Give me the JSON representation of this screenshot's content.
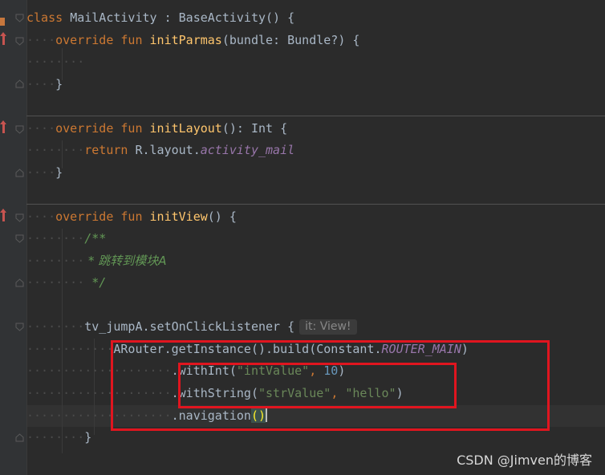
{
  "code": {
    "class_kw": "class",
    "class_name": "MailActivity",
    "class_rest": " : BaseActivity() {",
    "override_kw": "override",
    "fun_kw": "fun",
    "return_kw": "return",
    "m1_name": "initParmas",
    "m1_params": "(bundle: Bundle?) {",
    "close_brace": "}",
    "m2_name": "initLayout",
    "m2_sig": "(): Int {",
    "layout_ref": "R.layout.",
    "layout_name": "activity_mail",
    "m3_name": "initView",
    "m3_sig": "() {",
    "doc_open": "/**",
    "doc_text": " * 跳转到模块A",
    "doc_close": " */",
    "listener_call": "tv_jumpA.setOnClickListener {",
    "param_hint": "it: View!",
    "arouter_call": "ARouter.getInstance().build(Constant.",
    "router_const": "ROUTER_MAIN",
    "close_paren": ")",
    "with_int": ".withInt(",
    "int_key": "\"intValue\"",
    "comma": ", ",
    "int_val": "10",
    "with_string": ".withString(",
    "str_key": "\"strValue\"",
    "str_val": "\"hello\"",
    "navigation": ".navigation",
    "nav_parens": "()"
  },
  "watermark": "CSDN @Jimven的博客",
  "colors": {
    "background": "#2b2b2b",
    "keyword": "#cc7832",
    "function": "#ffc66d",
    "string": "#6a8759",
    "number": "#6897bb",
    "constant": "#9876aa",
    "comment": "#629755",
    "highlight_box": "#e0151f"
  }
}
